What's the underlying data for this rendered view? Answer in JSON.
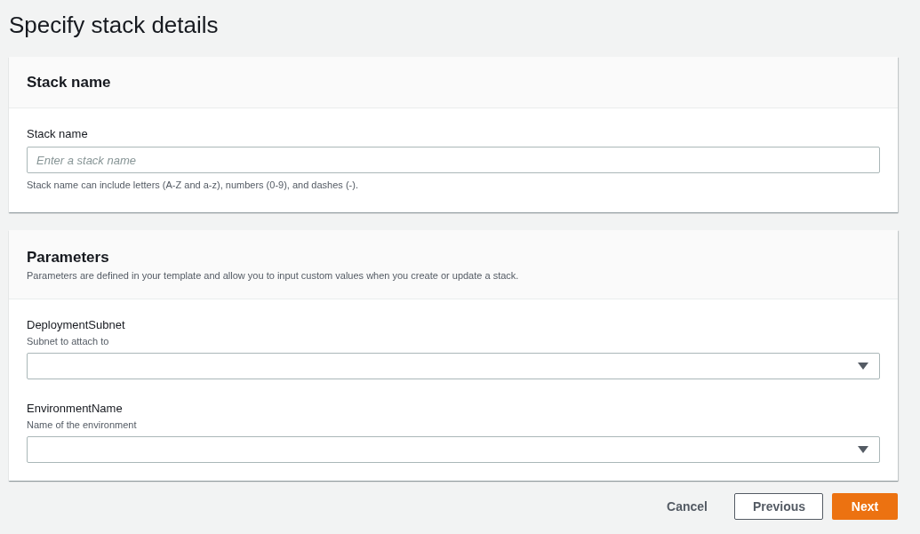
{
  "page_title": "Specify stack details",
  "stack_panel": {
    "title": "Stack name",
    "field": {
      "label": "Stack name",
      "placeholder": "Enter a stack name",
      "hint": "Stack name can include letters (A-Z and a-z), numbers (0-9), and dashes (-)."
    }
  },
  "parameters_panel": {
    "title": "Parameters",
    "description": "Parameters are defined in your template and allow you to input custom values when you create or update a stack.",
    "fields": [
      {
        "label": "DeploymentSubnet",
        "description": "Subnet to attach to"
      },
      {
        "label": "EnvironmentName",
        "description": "Name of the environment"
      }
    ]
  },
  "buttons": [
    {
      "label": "Cancel",
      "kind": "link"
    },
    {
      "label": "Previous",
      "kind": "secondary"
    },
    {
      "label": "Next",
      "kind": "primary"
    }
  ]
}
